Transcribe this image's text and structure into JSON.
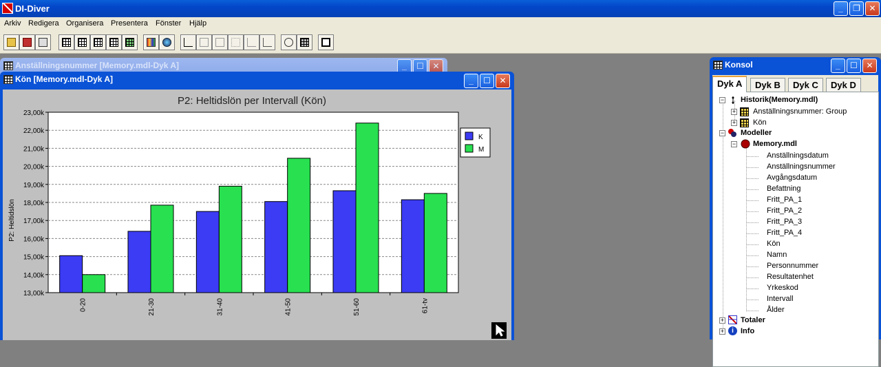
{
  "app": {
    "title": "DI-Diver",
    "menu": [
      "Arkiv",
      "Redigera",
      "Organisera",
      "Presentera",
      "Fönster",
      "Hjälp"
    ]
  },
  "window_back": {
    "title": "Anställningsnummer [Memory.mdl-Dyk A]"
  },
  "window_chart": {
    "title": "Kön [Memory.mdl-Dyk A]"
  },
  "chart_data": {
    "type": "bar",
    "title": "P2: Heltidslön per Intervall (Kön)",
    "ylabel": "P2: Heltidslön",
    "xlabel": "",
    "categories": [
      "0-20",
      "21-30",
      "31-40",
      "41-50",
      "51-60",
      "61-tv"
    ],
    "series": [
      {
        "name": "K",
        "color": "#3c3cf4",
        "values": [
          15050,
          16400,
          17500,
          18050,
          18650,
          18150
        ]
      },
      {
        "name": "M",
        "color": "#28e050",
        "values": [
          14000,
          17850,
          18900,
          20450,
          22400,
          18500
        ]
      }
    ],
    "ylim": [
      13000,
      23000
    ],
    "yticks": [
      "13,00k",
      "14,00k",
      "15,00k",
      "16,00k",
      "17,00k",
      "18,00k",
      "19,00k",
      "20,00k",
      "21,00k",
      "22,00k",
      "23,00k"
    ],
    "grid": true,
    "legend_position": "top-right"
  },
  "console": {
    "title": "Konsol",
    "tabs": [
      "Dyk A",
      "Dyk B",
      "Dyk C",
      "Dyk D"
    ],
    "history_label": "Historik(Memory.mdl)",
    "history_items": [
      "Anställningsnummer: Group",
      "Kön"
    ],
    "models_label": "Modeller",
    "model_label": "Memory.mdl",
    "fields": [
      "Anställningsdatum",
      "Anställningsnummer",
      "Avgångsdatum",
      "Befattning",
      "Fritt_PA_1",
      "Fritt_PA_2",
      "Fritt_PA_3",
      "Fritt_PA_4",
      "Kön",
      "Namn",
      "Personnummer",
      "Resultatenhet",
      "Yrkeskod",
      "Intervall",
      "Ålder"
    ],
    "totals_label": "Totaler",
    "info_label": "Info"
  },
  "colors": {
    "titlebar": "#0346c8",
    "bar_k": "#3c3cf4",
    "bar_m": "#28e050"
  }
}
